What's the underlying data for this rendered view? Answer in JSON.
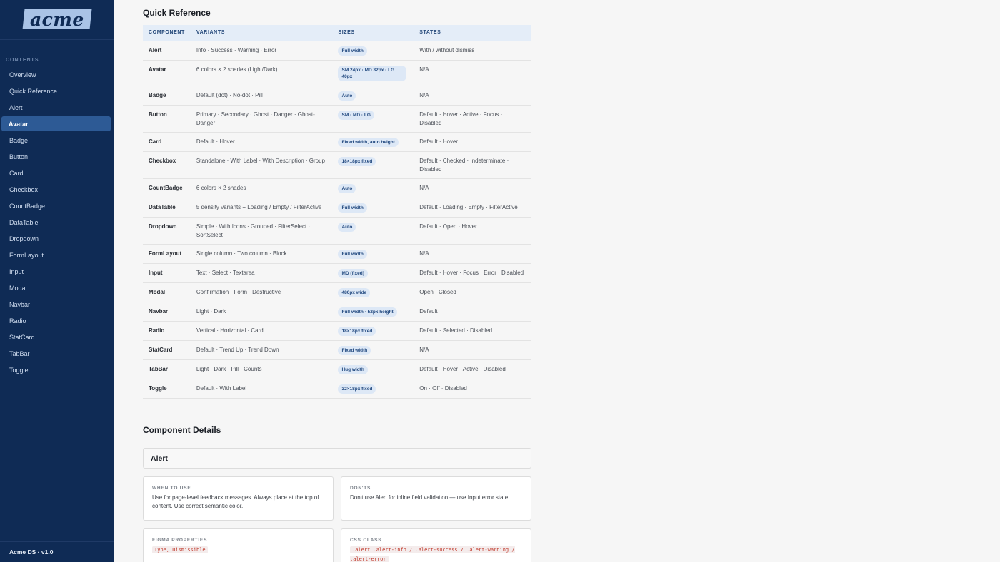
{
  "logo": "acme",
  "sidebar": {
    "contents_label": "CONTENTS",
    "items": [
      {
        "label": "Overview"
      },
      {
        "label": "Quick Reference"
      },
      {
        "label": "Alert"
      },
      {
        "label": "Avatar",
        "active": true
      },
      {
        "label": "Badge"
      },
      {
        "label": "Button"
      },
      {
        "label": "Card"
      },
      {
        "label": "Checkbox"
      },
      {
        "label": "CountBadge"
      },
      {
        "label": "DataTable"
      },
      {
        "label": "Dropdown"
      },
      {
        "label": "FormLayout"
      },
      {
        "label": "Input"
      },
      {
        "label": "Modal"
      },
      {
        "label": "Navbar"
      },
      {
        "label": "Radio"
      },
      {
        "label": "StatCard"
      },
      {
        "label": "TabBar"
      },
      {
        "label": "Toggle"
      }
    ],
    "footer": "Acme DS · v1.0"
  },
  "quick_reference": {
    "title": "Quick Reference",
    "headers": [
      "COMPONENT",
      "VARIANTS",
      "SIZES",
      "STATES"
    ],
    "rows": [
      {
        "component": "Alert",
        "variants": "Info · Success · Warning · Error",
        "sizes": "Full width",
        "states": "With / without dismiss"
      },
      {
        "component": "Avatar",
        "variants": "6 colors × 2 shades (Light/Dark)",
        "sizes": "SM 24px · MD 32px · LG 40px",
        "states": "N/A"
      },
      {
        "component": "Badge",
        "variants": "Default (dot) · No-dot · Pill",
        "sizes": "Auto",
        "states": "N/A"
      },
      {
        "component": "Button",
        "variants": "Primary · Secondary · Ghost · Danger · Ghost-Danger",
        "sizes": "SM · MD · LG",
        "states": "Default · Hover · Active · Focus · Disabled"
      },
      {
        "component": "Card",
        "variants": "Default · Hover",
        "sizes": "Fixed width, auto height",
        "states": "Default · Hover"
      },
      {
        "component": "Checkbox",
        "variants": "Standalone · With Label · With Description · Group",
        "sizes": "18×18px fixed",
        "states": "Default · Checked · Indeterminate · Disabled"
      },
      {
        "component": "CountBadge",
        "variants": "6 colors × 2 shades",
        "sizes": "Auto",
        "states": "N/A"
      },
      {
        "component": "DataTable",
        "variants": "5 density variants + Loading / Empty / FilterActive",
        "sizes": "Full width",
        "states": "Default · Loading · Empty · FilterActive"
      },
      {
        "component": "Dropdown",
        "variants": "Simple · With Icons · Grouped · FilterSelect · SortSelect",
        "sizes": "Auto",
        "states": "Default · Open · Hover"
      },
      {
        "component": "FormLayout",
        "variants": "Single column · Two column · Block",
        "sizes": "Full width",
        "states": "N/A"
      },
      {
        "component": "Input",
        "variants": "Text · Select · Textarea",
        "sizes": "MD (fixed)",
        "states": "Default · Hover · Focus · Error · Disabled"
      },
      {
        "component": "Modal",
        "variants": "Confirmation · Form · Destructive",
        "sizes": "480px wide",
        "states": "Open · Closed"
      },
      {
        "component": "Navbar",
        "variants": "Light · Dark",
        "sizes": "Full width · 52px height",
        "states": "Default"
      },
      {
        "component": "Radio",
        "variants": "Vertical · Horizontal · Card",
        "sizes": "18×18px fixed",
        "states": "Default · Selected · Disabled"
      },
      {
        "component": "StatCard",
        "variants": "Default · Trend Up · Trend Down",
        "sizes": "Fixed width",
        "states": "N/A"
      },
      {
        "component": "TabBar",
        "variants": "Light · Dark · Pill · Counts",
        "sizes": "Hug width",
        "states": "Default · Hover · Active · Disabled"
      },
      {
        "component": "Toggle",
        "variants": "Default · With Label",
        "sizes": "32×18px fixed",
        "states": "On · Off · Disabled"
      }
    ]
  },
  "component_details": {
    "title": "Component Details",
    "alert": {
      "heading": "Alert",
      "when_to_use_label": "WHEN TO USE",
      "when_to_use_text": "Use for page-level feedback messages. Always place at the top of content. Use correct semantic color.",
      "donts_label": "DON'TS",
      "donts_text": "Don't use Alert for inline field validation — use Input error state.",
      "figma_label": "FIGMA PROPERTIES",
      "figma_value": "Type, Dismissible",
      "css_label": "CSS CLASS",
      "css_value": ".alert .alert-info / .alert-success / .alert-warning / .alert-error"
    }
  }
}
